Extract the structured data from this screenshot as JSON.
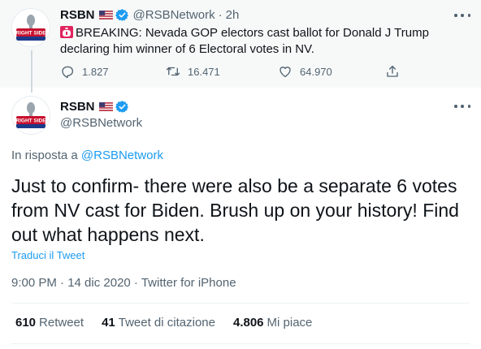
{
  "parent_tweet": {
    "display_name": "RSBN",
    "handle": "@RSBNetwork",
    "separator": "·",
    "time": "2h",
    "text": "BREAKING: Nevada GOP electors cast ballot for Donald J Trump declaring him winner of 6 Electoral votes in NV.",
    "avatar_label": "RIGHT SIDE",
    "reply_count": "1.827",
    "retweet_count": "16.471",
    "like_count": "64.970"
  },
  "main_tweet": {
    "display_name": "RSBN",
    "handle": "@RSBNetwork",
    "avatar_label": "RIGHT SIDE",
    "reply_prefix": "In risposta a",
    "reply_to_handle": "@RSBNetwork",
    "text": "Just to confirm- there were also be a separate 6 votes from NV cast for Biden. Brush up on your history! Find out what happens next.",
    "translate_label": "Traduci il Tweet",
    "timestamp": "9:00 PM · 14 dic 2020 · Twitter for iPhone"
  },
  "stats": {
    "retweets_count": "610",
    "retweets_label": "Retweet",
    "quotes_count": "41",
    "quotes_label": "Tweet di citazione",
    "likes_count": "4.806",
    "likes_label": "Mi piace"
  },
  "colors": {
    "accent": "#1d9bf0",
    "secondary_text": "#536471",
    "parent_bg": "#f7f9f9"
  }
}
